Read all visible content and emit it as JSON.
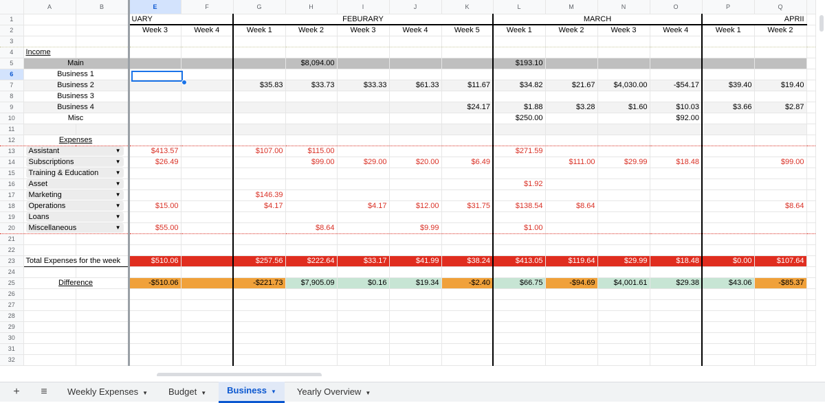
{
  "columns": [
    "A",
    "B",
    "E",
    "F",
    "G",
    "H",
    "I",
    "J",
    "K",
    "L",
    "M",
    "N",
    "O",
    "P",
    "Q"
  ],
  "rows": [
    "1",
    "2",
    "3",
    "4",
    "5",
    "6",
    "7",
    "8",
    "9",
    "10",
    "11",
    "12",
    "13",
    "14",
    "15",
    "16",
    "17",
    "18",
    "19",
    "20",
    "21",
    "22",
    "23",
    "24",
    "25",
    "26",
    "27",
    "28",
    "29",
    "30",
    "31",
    "32"
  ],
  "months": {
    "jan": "UARY",
    "feb": "FEBURARY",
    "mar": "MARCH",
    "apr": "APRII"
  },
  "weeks": [
    "Week 3",
    "Week 4",
    "Week 1",
    "Week 2",
    "Week 3",
    "Week 4",
    "Week 5",
    "Week 1",
    "Week 2",
    "Week 3",
    "Week 4",
    "Week 1",
    "Week 2"
  ],
  "income": {
    "label": "Income",
    "rows": [
      {
        "label": "Main",
        "values": [
          "",
          "",
          "",
          "$8,094.00",
          "",
          "",
          "",
          "$193.10",
          "",
          "",
          "",
          "",
          ""
        ]
      },
      {
        "label": "Business 1",
        "values": [
          "",
          "",
          "",
          "",
          "",
          "",
          "",
          "",
          "",
          "",
          "",
          "",
          ""
        ]
      },
      {
        "label": "Business 2",
        "values": [
          "",
          "",
          "$35.83",
          "$33.73",
          "$33.33",
          "$61.33",
          "$11.67",
          "$34.82",
          "$21.67",
          "$4,030.00",
          "-$54.17",
          "$39.40",
          "$19.40"
        ]
      },
      {
        "label": "Business 3",
        "values": [
          "",
          "",
          "",
          "",
          "",
          "",
          "",
          "",
          "",
          "",
          "",
          "",
          ""
        ]
      },
      {
        "label": "Business 4",
        "values": [
          "",
          "",
          "",
          "",
          "",
          "",
          "$24.17",
          "$1.88",
          "$3.28",
          "$1.60",
          "$10.03",
          "$3.66",
          "$2.87"
        ]
      },
      {
        "label": "Misc",
        "values": [
          "",
          "",
          "",
          "",
          "",
          "",
          "",
          "$250.00",
          "",
          "",
          "$92.00",
          "",
          ""
        ]
      }
    ]
  },
  "expenses": {
    "label": "Expenses",
    "rows": [
      {
        "label": "Assistant",
        "values": [
          "$413.57",
          "",
          "$107.00",
          "$115.00",
          "",
          "",
          "",
          "$271.59",
          "",
          "",
          "",
          "",
          ""
        ]
      },
      {
        "label": "Subscriptions",
        "values": [
          "$26.49",
          "",
          "",
          "$99.00",
          "$29.00",
          "$20.00",
          "$6.49",
          "",
          "$111.00",
          "$29.99",
          "$18.48",
          "",
          "$99.00"
        ]
      },
      {
        "label": "Training & Education",
        "values": [
          "",
          "",
          "",
          "",
          "",
          "",
          "",
          "",
          "",
          "",
          "",
          "",
          ""
        ]
      },
      {
        "label": "Asset",
        "values": [
          "",
          "",
          "",
          "",
          "",
          "",
          "",
          "$1.92",
          "",
          "",
          "",
          "",
          ""
        ]
      },
      {
        "label": "Marketing",
        "values": [
          "",
          "",
          "$146.39",
          "",
          "",
          "",
          "",
          "",
          "",
          "",
          "",
          "",
          ""
        ]
      },
      {
        "label": "Operations",
        "values": [
          "$15.00",
          "",
          "$4.17",
          "",
          "$4.17",
          "$12.00",
          "$31.75",
          "$138.54",
          "$8.64",
          "",
          "",
          "",
          "$8.64"
        ]
      },
      {
        "label": "Loans",
        "values": [
          "",
          "",
          "",
          "",
          "",
          "",
          "",
          "",
          "",
          "",
          "",
          "",
          ""
        ]
      },
      {
        "label": "Miscellaneous",
        "values": [
          "$55.00",
          "",
          "",
          "$8.64",
          "",
          "$9.99",
          "",
          "$1.00",
          "",
          "",
          "",
          "",
          ""
        ]
      }
    ]
  },
  "total": {
    "label": "Total Expenses for the week",
    "values": [
      "$510.06",
      "",
      "$257.56",
      "$222.64",
      "$33.17",
      "$41.99",
      "$38.24",
      "$413.05",
      "$119.64",
      "$29.99",
      "$18.48",
      "$0.00",
      "$107.64"
    ]
  },
  "difference": {
    "label": "Difference",
    "values": [
      "-$510.06",
      "",
      "-$221.73",
      "$7,905.09",
      "$0.16",
      "$19.34",
      "-$2.40",
      "$66.75",
      "-$94.69",
      "$4,001.61",
      "$29.38",
      "$43.06",
      "-$85.37"
    ]
  },
  "tabs": [
    {
      "label": "Weekly Expenses"
    },
    {
      "label": "Budget"
    },
    {
      "label": "Business"
    },
    {
      "label": "Yearly Overview"
    }
  ],
  "colors": {
    "accent": "#0b57d0",
    "total_red": "#e02d1f",
    "diff_orange": "#f0a13a",
    "diff_green": "#c7e5d4",
    "negative_text": "#d93025"
  }
}
